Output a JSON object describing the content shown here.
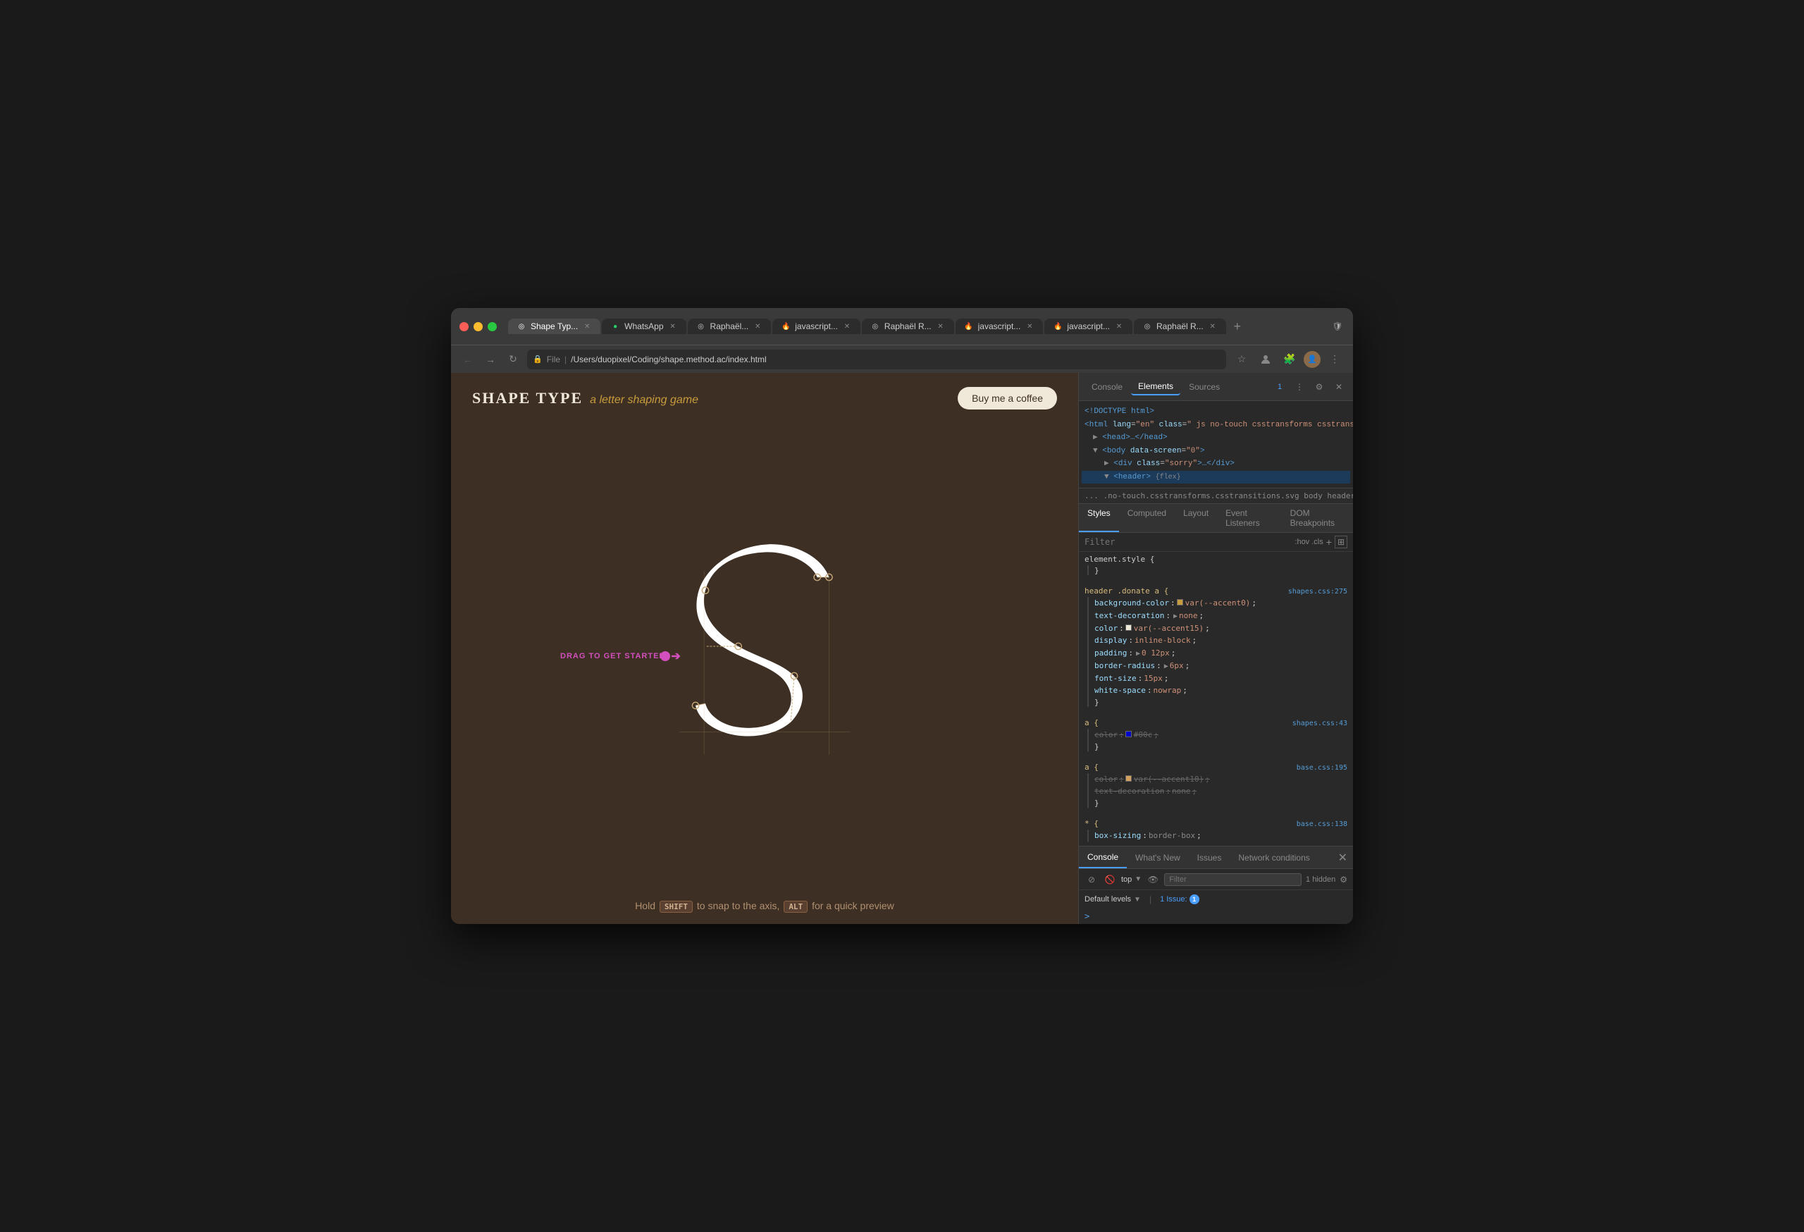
{
  "window": {
    "title": "Shape Type - a letter shaping game"
  },
  "tabs": [
    {
      "id": "shape-type",
      "label": "Shape Typ...",
      "favicon": "◎",
      "active": true,
      "closable": true
    },
    {
      "id": "whatsapp",
      "label": "WhatsApp",
      "favicon": "📱",
      "active": false,
      "closable": true
    },
    {
      "id": "raphael1",
      "label": "Raphaël...",
      "favicon": "◎",
      "active": false,
      "closable": true
    },
    {
      "id": "javascript1",
      "label": "javascript...",
      "favicon": "🔥",
      "active": false,
      "closable": true
    },
    {
      "id": "raphael2",
      "label": "Raphaël R...",
      "favicon": "◎",
      "active": false,
      "closable": true
    },
    {
      "id": "javascript2",
      "label": "javascript...",
      "favicon": "🔥",
      "active": false,
      "closable": true
    },
    {
      "id": "javascript3",
      "label": "javascript...",
      "favicon": "🔥",
      "active": false,
      "closable": true
    },
    {
      "id": "raphael3",
      "label": "Raphaël R...",
      "favicon": "◎",
      "active": false,
      "closable": true
    }
  ],
  "addressbar": {
    "url": "/Users/duopixel/Coding/shape.method.ac/index.html",
    "protocol": "File"
  },
  "page": {
    "logo_main": "SHAPE TYPE",
    "logo_sub": "a letter shaping game",
    "buy_coffee": "Buy me a coffee",
    "drag_label": "DRAG TO GET STARTED",
    "hint_text_1": "Hold",
    "hint_shift": "SHIFT",
    "hint_text_2": "to snap to the axis,",
    "hint_alt": "ALT",
    "hint_text_3": "for a quick preview"
  },
  "devtools": {
    "tabs": [
      "Console",
      "Elements",
      "Sources"
    ],
    "active_tab": "Elements",
    "html_lines": [
      {
        "text": "<!DOCTYPE html>",
        "indent": 0,
        "selected": false
      },
      {
        "text": "<html lang=\"en\" class=\" js no-touch csstransforms csstransitions svg\">",
        "indent": 0,
        "selected": false
      },
      {
        "text": "▶ <head>…</head>",
        "indent": 1,
        "selected": false
      },
      {
        "text": "▼ <body data-screen=\"0\">",
        "indent": 1,
        "selected": false
      },
      {
        "text": "▶ <div class=\"sorry\">…</div>",
        "indent": 2,
        "selected": false
      },
      {
        "text": "▼ <header> {flex}",
        "indent": 2,
        "selected": true
      }
    ],
    "breadcrumb": "... .no-touch.csstransforms.csstransitions.svg  body  header  div.donate  a  ...",
    "styles_tabs": [
      "Styles",
      "Computed",
      "Layout",
      "Event Listeners",
      "DOM Breakpoints"
    ],
    "active_styles_tab": "Styles",
    "filter_placeholder": "Filter",
    "filter_right": ":hov  .cls",
    "style_rules": [
      {
        "selector": "element.style {",
        "source": "",
        "properties": []
      },
      {
        "selector": "header .donate a {",
        "source": "shapes.css:275",
        "properties": [
          {
            "name": "background-color:",
            "value": "var(--accent0)",
            "swatch": "#c89b3c",
            "crossed": false
          },
          {
            "name": "text-decoration:",
            "value": "none",
            "arrow": true,
            "crossed": false
          },
          {
            "name": "color:",
            "value": "var(--accent15)",
            "swatch": "#f0e8d8",
            "crossed": false
          },
          {
            "name": "display:",
            "value": "inline-block",
            "crossed": false
          },
          {
            "name": "padding:",
            "value": "0 12px",
            "arrow": true,
            "crossed": false
          },
          {
            "name": "border-radius:",
            "value": "6px",
            "arrow": true,
            "crossed": false
          },
          {
            "name": "font-size:",
            "value": "15px",
            "crossed": false
          },
          {
            "name": "white-space:",
            "value": "nowrap",
            "crossed": false
          }
        ]
      },
      {
        "selector": "a {",
        "source": "shapes.css:43",
        "properties": [
          {
            "name": "color:",
            "value": "#00c",
            "swatch": "#0000cc",
            "crossed": true
          }
        ]
      },
      {
        "selector": "a {",
        "source": "base.css:195",
        "properties": [
          {
            "name": "color:",
            "value": "var(--accent10)",
            "swatch": "#d4a060",
            "crossed": true
          },
          {
            "name": "text-decoration:",
            "value": "none",
            "crossed": true
          }
        ]
      },
      {
        "selector": "* {",
        "source": "base.css:138",
        "properties": [
          {
            "name": "box-sizing:",
            "value": "border-box",
            "partial": true
          }
        ]
      }
    ],
    "console_tabs": [
      "Console",
      "What's New",
      "Issues",
      "Network conditions"
    ],
    "active_console_tab": "Console",
    "console_context": "top",
    "console_filter_placeholder": "Filter",
    "hidden_count": "1 hidden",
    "default_levels": "Default levels",
    "issues": "1 Issue:",
    "issues_count": "1",
    "prompt_symbol": ">"
  }
}
